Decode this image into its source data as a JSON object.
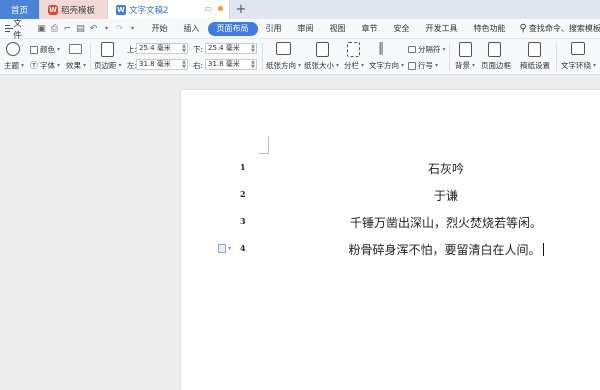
{
  "tabs": {
    "home": "首页",
    "wps_templates": "稻壳模板",
    "document": "文字文稿2",
    "new_tab": "+"
  },
  "menu": {
    "file": "文件",
    "items": [
      "开始",
      "插入",
      "页面布局",
      "引用",
      "审阅",
      "视图",
      "章节",
      "安全",
      "开发工具",
      "特色功能"
    ],
    "active_index": 2,
    "search": "查找命令、搜索模板"
  },
  "ribbon": {
    "theme": "主题",
    "colors": "颜色",
    "fonts": "字体",
    "effects": "效果",
    "margins": "页边距",
    "top_label": "上:",
    "top_value": "25.4 毫米",
    "bottom_label": "下:",
    "bottom_value": "25.4 毫米",
    "left_label": "左:",
    "left_value": "31.8 毫米",
    "right_label": "右:",
    "right_value": "31.8 毫米",
    "orientation": "纸张方向",
    "paper_size": "纸张大小",
    "columns": "分栏",
    "text_direction": "文字方向",
    "separator": "分隔符",
    "line_numbers": "行号",
    "background": "背景",
    "page_border": "页面边框",
    "manuscript": "稿纸设置",
    "text_wrap": "文字环绕"
  },
  "document": {
    "lines": [
      {
        "num": "1",
        "text": "石灰吟"
      },
      {
        "num": "2",
        "text": "于谦"
      },
      {
        "num": "3",
        "text": "千锤万凿出深山，烈火焚烧若等闲。"
      },
      {
        "num": "4",
        "text": "粉骨碎身浑不怕，要留清白在人间。"
      }
    ]
  },
  "colors": {
    "accent": "#3f7be0",
    "home_tab": "#4a84d6",
    "wps_tab": "#f3d9d5"
  }
}
